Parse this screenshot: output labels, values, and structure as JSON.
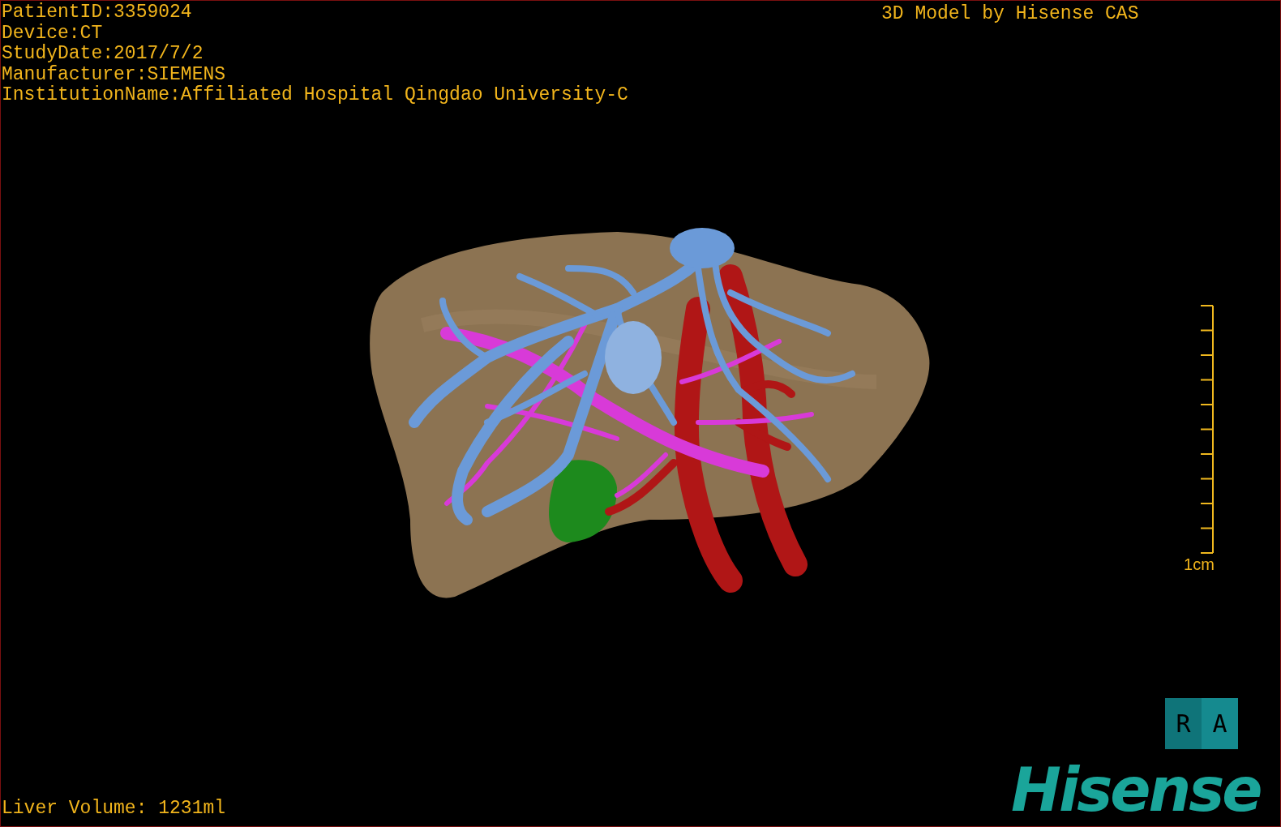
{
  "patient_info": [
    "PatientID:3359024",
    "Device:CT",
    "StudyDate:2017/7/2",
    "Manufacturer:SIEMENS",
    "InstitutionName:Affiliated Hospital Qingdao University-C"
  ],
  "title": "3D Model by Hisense CAS",
  "scale_bar": {
    "label": "1cm"
  },
  "orientation_cube": {
    "left_face": "R",
    "front_face": "A"
  },
  "logo": "Hisense",
  "liver_volume": "Liver Volume: 1231ml"
}
